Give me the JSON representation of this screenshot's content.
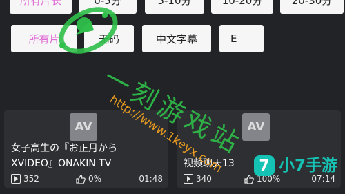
{
  "filters": {
    "duration_row": [
      "所有片长",
      "0-5分",
      "5-10分",
      "10-20分",
      "20-30分"
    ],
    "tag_row": [
      "所有片",
      "无码",
      "中文字幕",
      "Ε"
    ]
  },
  "videos": [
    {
      "thumb_badge": "AV",
      "title_line1": "女子高生の『お正月から",
      "title_line2": "XVIDEO』ONAKIN TV",
      "views": "352",
      "likes": "0%",
      "duration": "01:48"
    },
    {
      "thumb_badge": "AV",
      "title_line1": "视频聊天13",
      "views": "340",
      "likes": "100%",
      "duration": "07:14"
    }
  ],
  "watermark": {
    "cn_text": "一刻游戏站",
    "url_text": "http://www.1keyx.com",
    "logo_digit": "7",
    "logo_text": "小7手游"
  },
  "colors": {
    "background": "#222326",
    "card": "#2e2f33",
    "chip": "#f6f6f6",
    "active_chip_text": "#e06bd7",
    "watermark_green": "#2fbf4a",
    "watermark_orange": "#f0a020",
    "logo_teal": "#15c3b5"
  }
}
